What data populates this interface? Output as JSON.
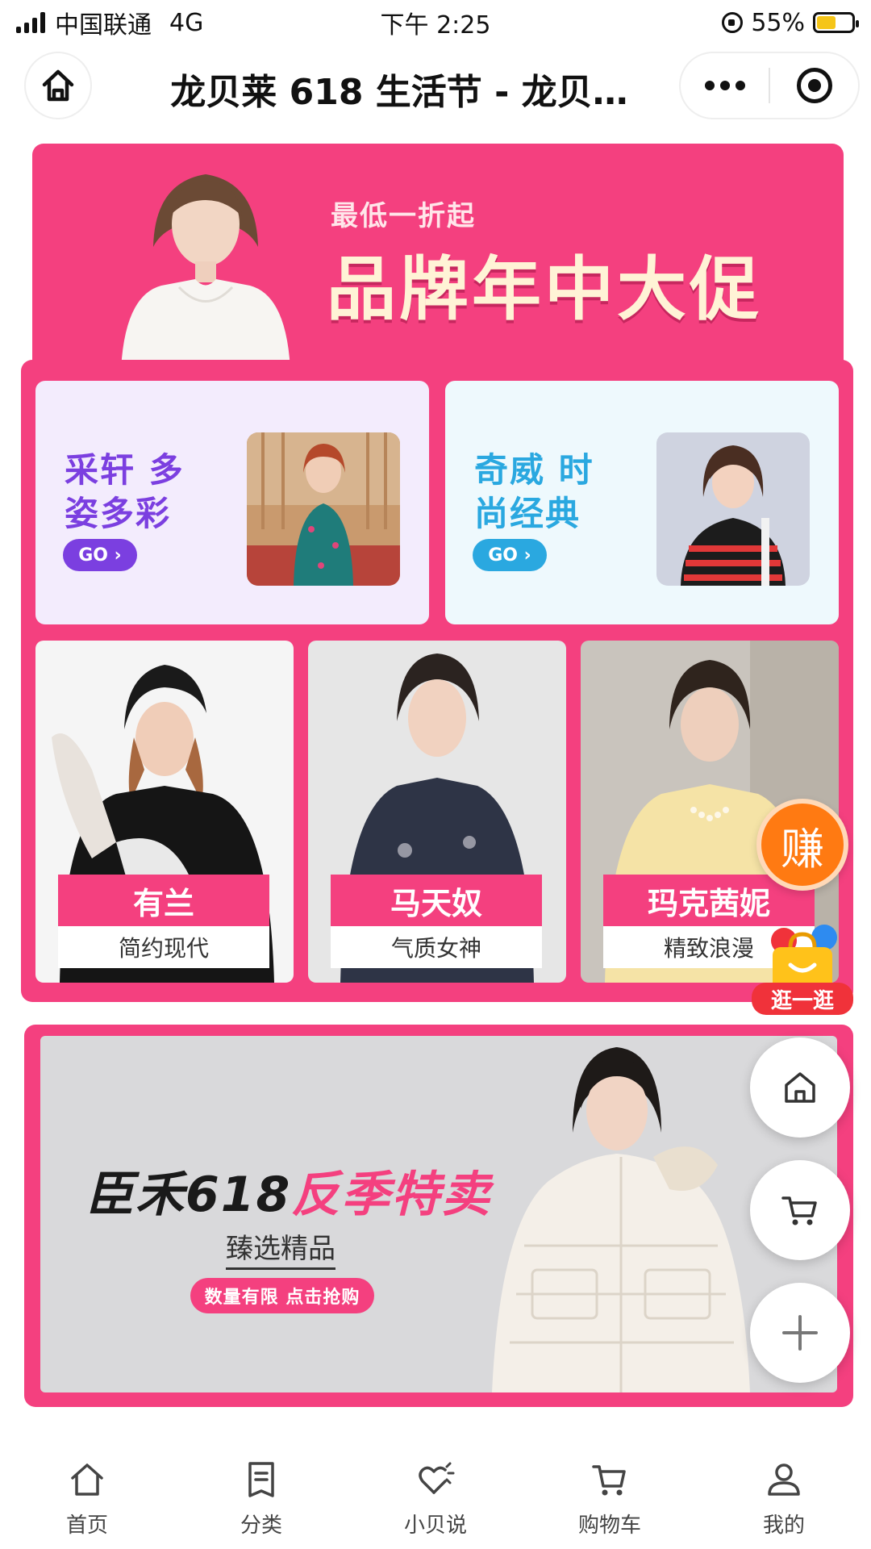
{
  "status_bar": {
    "carrier": "中国联通",
    "network": "4G",
    "time": "下午 2:25",
    "battery_percent": "55%",
    "battery_level": 0.55
  },
  "nav_bar": {
    "title": "龙贝莱 618 生活节 - 龙贝…",
    "home_icon": "home-outline-icon",
    "more_icon": "more-dots-icon",
    "close_icon": "target-close-icon"
  },
  "hero_banner": {
    "subtitle": "最低一折起",
    "title": "品牌年中大促",
    "background_color": "#f4407f"
  },
  "promo_cards": [
    {
      "title": "采轩 多姿多彩",
      "button_label": "GO ›",
      "accent_color": "#7b3fe0",
      "background_color": "#f3ecfd"
    },
    {
      "title": "奇威 时尚经典",
      "button_label": "GO ›",
      "accent_color": "#2aa8e0",
      "background_color": "#eef9fd"
    }
  ],
  "brand_tiles": [
    {
      "name": "有兰",
      "tagline": "简约现代"
    },
    {
      "name": "马天奴",
      "tagline": "气质女神"
    },
    {
      "name": "玛克茜妮",
      "tagline": "精致浪漫"
    }
  ],
  "sale_banner": {
    "title_part1": "臣禾618",
    "title_part2": "反季特卖",
    "subtitle": "臻选精品",
    "pill": "数量有限 点击抢购"
  },
  "floating": {
    "earn_label": "赚",
    "stroll_label": "逛一逛",
    "home_icon": "home-icon",
    "cart_icon": "cart-icon",
    "add_icon": "plus-icon"
  },
  "tab_bar": [
    {
      "label": "首页",
      "icon": "home-icon"
    },
    {
      "label": "分类",
      "icon": "list-icon"
    },
    {
      "label": "小贝说",
      "icon": "heart-sparkle-icon"
    },
    {
      "label": "购物车",
      "icon": "cart-icon"
    },
    {
      "label": "我的",
      "icon": "user-icon"
    }
  ]
}
